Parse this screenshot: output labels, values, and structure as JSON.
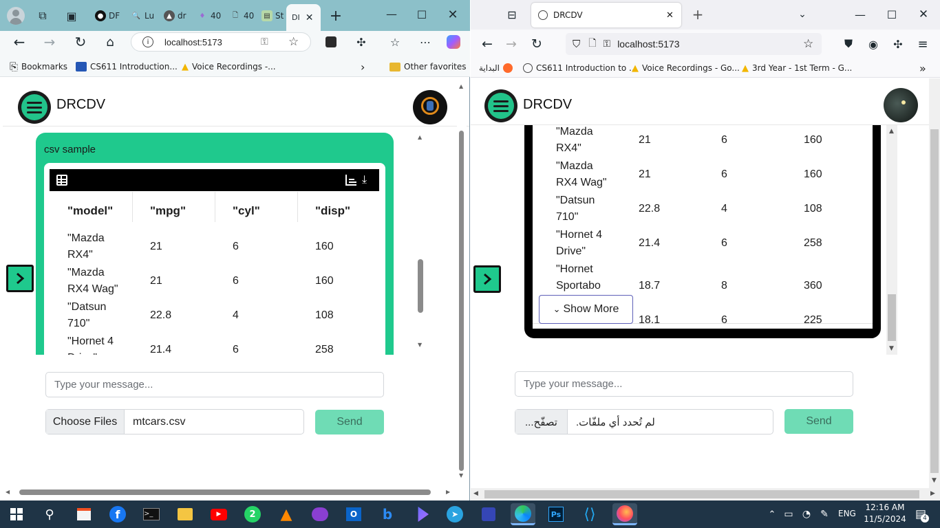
{
  "edge": {
    "tabs": [
      {
        "label": "DF"
      },
      {
        "label": "Lu"
      },
      {
        "label": "dr"
      },
      {
        "label": "40"
      },
      {
        "label": "40"
      },
      {
        "label": "St"
      },
      {
        "label": "DI"
      }
    ],
    "address": "localhost:5173",
    "bookmarks": [
      {
        "label": "Bookmarks"
      },
      {
        "label": "CS611 Introduction..."
      },
      {
        "label": "Voice Recordings -..."
      }
    ],
    "other_favorites": "Other favorites"
  },
  "firefox": {
    "tab_title": "DRCDV",
    "address": "localhost:5173",
    "bookmarks": [
      {
        "label": "البداية"
      },
      {
        "label": "CS611 Introduction to ..."
      },
      {
        "label": "Voice Recordings - Go..."
      },
      {
        "label": "3rd Year - 1st Term - G..."
      }
    ]
  },
  "app": {
    "brand": "DRCDV",
    "panel_title": "csv sample",
    "columns": [
      "\"model\"",
      "\"mpg\"",
      "\"cyl\"",
      "\"disp\""
    ],
    "rows": [
      {
        "model": [
          "\"Mazda",
          "RX4\""
        ],
        "mpg": "21",
        "cyl": "6",
        "disp": "160"
      },
      {
        "model": [
          "\"Mazda",
          "RX4 Wag\""
        ],
        "mpg": "21",
        "cyl": "6",
        "disp": "160"
      },
      {
        "model": [
          "\"Datsun",
          "710\""
        ],
        "mpg": "22.8",
        "cyl": "4",
        "disp": "108"
      },
      {
        "model": [
          "\"Hornet 4",
          "Drive\""
        ],
        "mpg": "21.4",
        "cyl": "6",
        "disp": "258"
      },
      {
        "model": [
          "\"Hornet",
          "Sportabo"
        ],
        "mpg": "18.7",
        "cyl": "8",
        "disp": "360"
      },
      {
        "model": [
          "",
          ""
        ],
        "mpg": "18.1",
        "cyl": "6",
        "disp": "225"
      }
    ],
    "show_more": "Show More",
    "message_placeholder": "Type your message...",
    "choose_files": "Choose Files",
    "file_name": "mtcars.csv",
    "send": "Send",
    "ff_choose_files": "...تصفّح",
    "ff_no_file": "لم تُحدد أي ملفّات."
  },
  "taskbar": {
    "lang": "ENG",
    "time": "12:16 AM",
    "date": "11/5/2024",
    "notif_count": "4",
    "whatsapp_badge": "2"
  },
  "colors": {
    "accent_green": "#1fc98d",
    "send_disabled": "#6fdcb5",
    "edge_tabstrip": "#8cc0c9",
    "taskbar": "#1f3446"
  }
}
